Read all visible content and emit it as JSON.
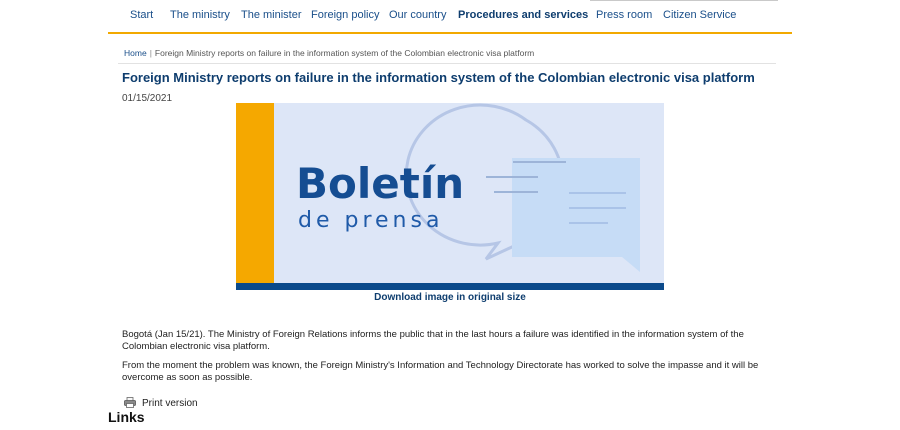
{
  "nav": {
    "items": [
      {
        "label": "Start"
      },
      {
        "label": "The ministry"
      },
      {
        "label": "The minister"
      },
      {
        "label": "Foreign policy"
      },
      {
        "label": "Our country"
      },
      {
        "label": "Procedures and services",
        "active": true
      },
      {
        "label": "Press room"
      },
      {
        "label": "Citizen Service"
      }
    ],
    "accent_color": "#f2a900"
  },
  "breadcrumb": {
    "home": "Home",
    "separator": "|",
    "current": "Foreign Ministry reports on failure in the information system of the Colombian electronic visa platform"
  },
  "article": {
    "title": "Foreign Ministry reports on failure in the information system of the Colombian electronic visa platform",
    "date": "01/15/2021",
    "image": {
      "heading": "Boletín",
      "subheading": "de prensa",
      "colors": {
        "background": "#dde6f7",
        "stripe": "#f5a800",
        "footer_bar": "#0b4a8b",
        "brand_text": "#154d92",
        "sub_text": "#1f5aa8"
      }
    },
    "download_label": "Download image in original size",
    "paragraphs": [
      "Bogotá (Jan 15/21). The Ministry of Foreign Relations informs the public that in the last hours a failure was identified in the information system of the Colombian electronic visa platform.",
      "From the moment the problem was known, the Foreign Ministry's Information and Technology Directorate has worked to solve the impasse and it will be overcome as soon as possible."
    ],
    "print_label": "Print version",
    "print_icon": "printer-icon"
  },
  "links_heading": "Links"
}
